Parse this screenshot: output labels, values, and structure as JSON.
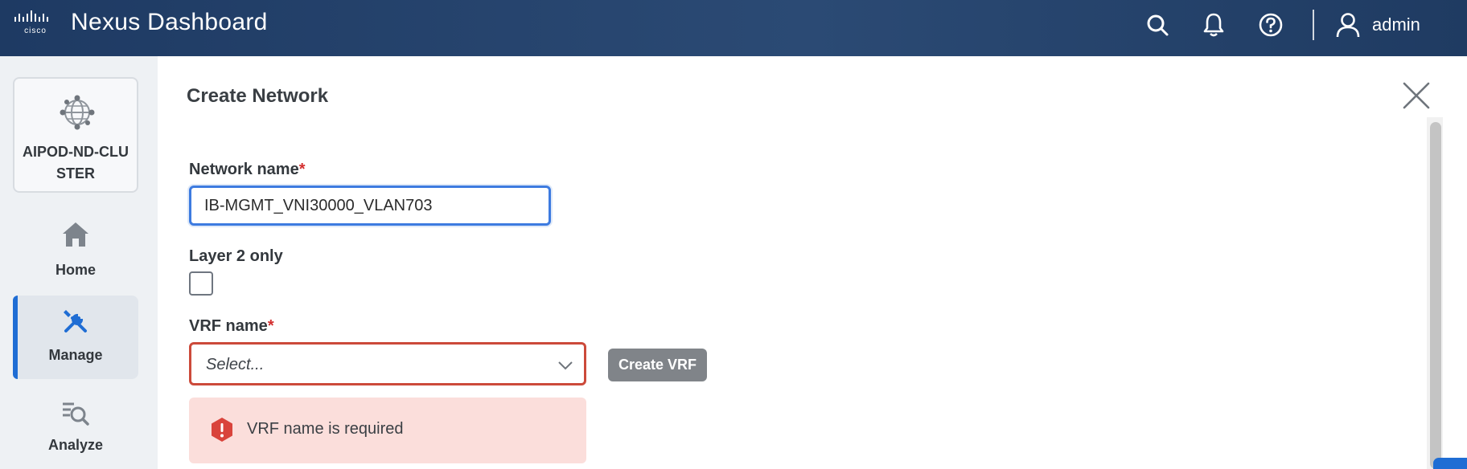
{
  "header": {
    "brand_logo": "cisco-logo",
    "app_title": "Nexus Dashboard",
    "icons": [
      "search-icon",
      "bell-icon",
      "help-icon",
      "user-icon"
    ],
    "user_name": "admin"
  },
  "sidebar": {
    "cluster": {
      "icon": "cluster-globe-icon",
      "name": "AIPOD-ND-CLUSTER"
    },
    "items": [
      {
        "label": "Home",
        "icon": "home-icon",
        "active": false
      },
      {
        "label": "Manage",
        "icon": "tools-icon",
        "active": true
      },
      {
        "label": "Analyze",
        "icon": "analyze-icon",
        "active": false
      }
    ],
    "active_color": "#1f6dd4"
  },
  "form": {
    "title": "Create Network",
    "network_name": {
      "label": "Network name",
      "required_mark": "*",
      "value": "IB-MGMT_VNI30000_VLAN703"
    },
    "layer2_only": {
      "label": "Layer 2 only",
      "checked": false
    },
    "vrf_name": {
      "label": "VRF name",
      "required_mark": "*",
      "placeholder": "Select..."
    },
    "create_vrf_button": "Create VRF",
    "error_message": "VRF name is required"
  },
  "colors": {
    "header_bg": "#24426b",
    "focus_border": "#3d7be0",
    "error_border": "#cc4a3a",
    "error_bg": "#fbdedb",
    "required_mark": "#d32f2f"
  }
}
